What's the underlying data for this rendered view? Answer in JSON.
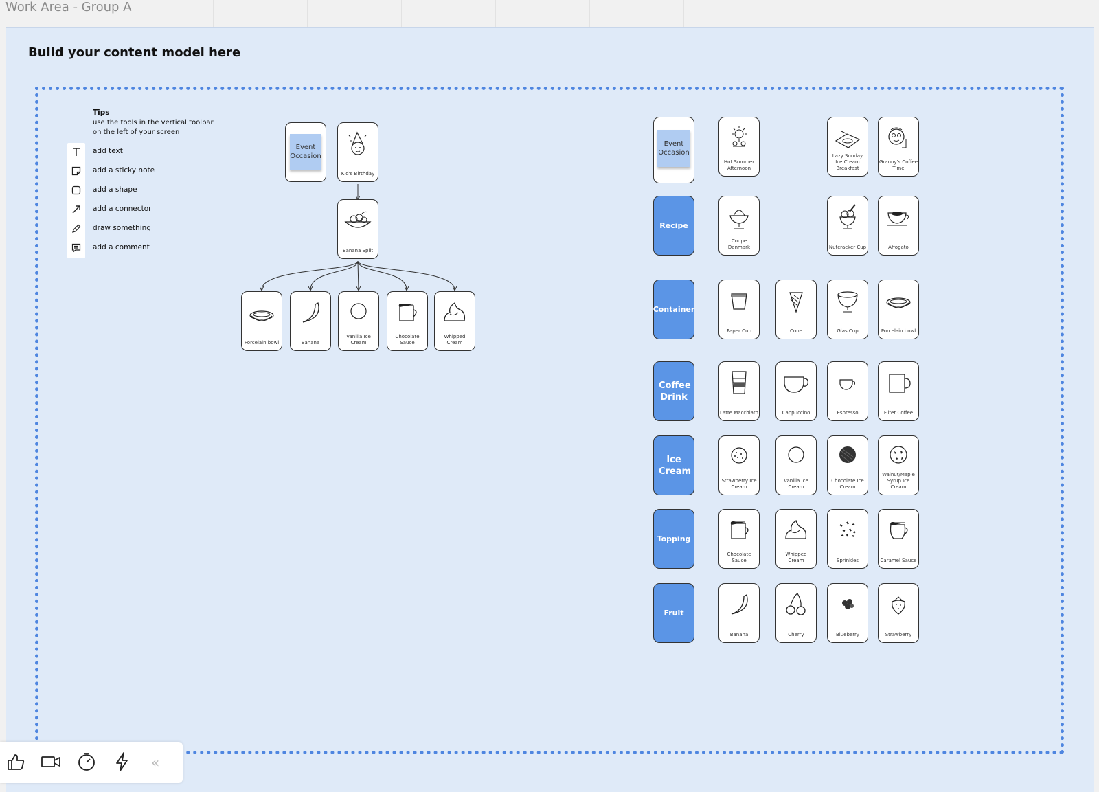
{
  "canvas": {
    "title": "Work Area - Group A"
  },
  "frame": {
    "title": "Build your content model here"
  },
  "tips": {
    "title": "Tips",
    "description": "use the tools in the vertical toolbar on the left of your screen",
    "items": [
      {
        "label": "add text",
        "icon": "text-icon"
      },
      {
        "label": "add a sticky note",
        "icon": "sticky-note-icon"
      },
      {
        "label": "add a shape",
        "icon": "shape-icon"
      },
      {
        "label": "add a connector",
        "icon": "connector-icon"
      },
      {
        "label": "draw something",
        "icon": "pencil-icon"
      },
      {
        "label": "add a comment",
        "icon": "comment-icon"
      }
    ]
  },
  "tree": {
    "event_sticky": "Event Occasion",
    "kids_birthday": "Kid's Birthday",
    "banana_split": "Banana Split",
    "children": [
      "Porcelain bowl",
      "Banana",
      "Vanilla Ice Cream",
      "Chocolate Sauce",
      "Whipped Cream"
    ]
  },
  "model": {
    "event_sticky": "Event Occasion",
    "events": [
      "Hot Summer Afternoon",
      "Lazy Sunday Ice Cream Breakfast",
      "Granny's Coffee Time"
    ],
    "categories": [
      "Recipe",
      "Container",
      "Coffee Drink",
      "Ice Cream",
      "Topping",
      "Fruit"
    ],
    "recipe": [
      "Coupe Danmark",
      "Nutcracker Cup",
      "Affogato"
    ],
    "container": [
      "Paper Cup",
      "Cone",
      "Glas Cup",
      "Porcelain bowl"
    ],
    "coffee_drink": [
      "Latte Macchiato",
      "Cappuccino",
      "Espresso",
      "Filter Coffee"
    ],
    "ice_cream": [
      "Strawberry Ice Cream",
      "Vanilla Ice Cream",
      "Chocolate Ice Cream",
      "Walnut/Maple Syrup Ice Cream"
    ],
    "topping": [
      "Chocolate Sauce",
      "Whipped Cream",
      "Sprinkles",
      "Caramel Sauce"
    ],
    "fruit": [
      "Banana",
      "Cherry",
      "Blueberry",
      "Strawberry"
    ]
  },
  "bottom_toolbar": {
    "icons": [
      "thumbs-up-icon",
      "video-camera-icon",
      "timer-icon",
      "lightning-icon",
      "collapse-icon"
    ],
    "collapse_label": "«"
  },
  "colors": {
    "frame_bg": "#dfeaf8",
    "accent": "#5b95e6",
    "dotted_border": "#4f86e0",
    "sticky": "#b0ccf2"
  }
}
